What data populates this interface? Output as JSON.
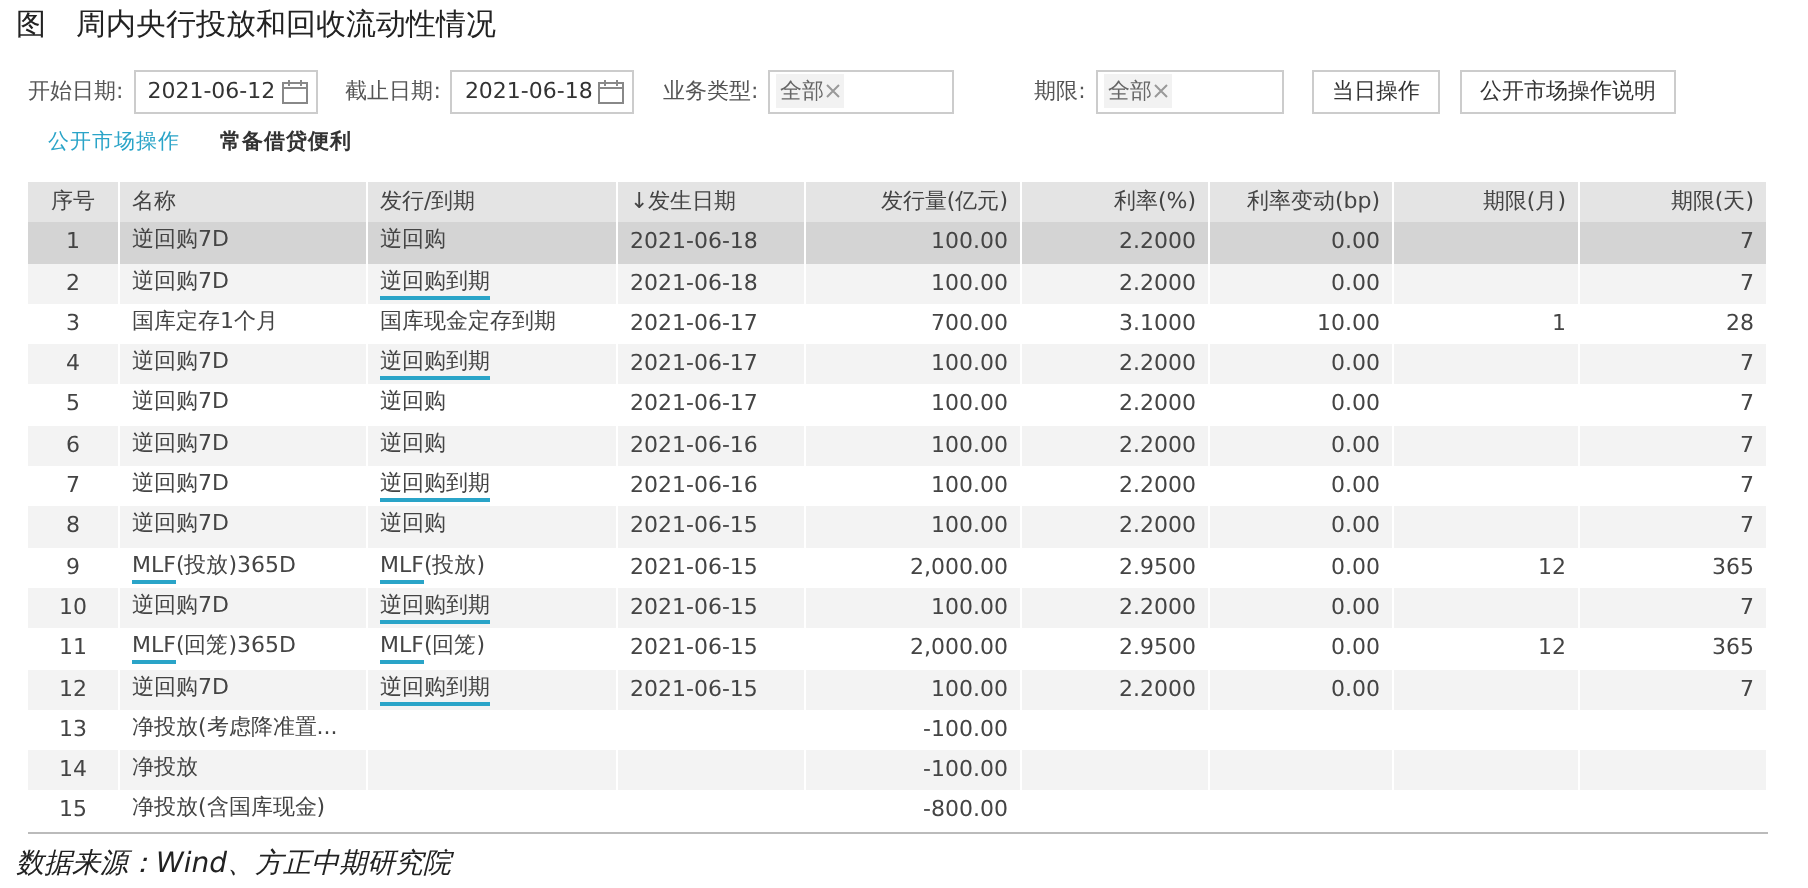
{
  "title": "图　周内央行投放和回收流动性情况",
  "filters": [
    {
      "label": "开始日期:",
      "kind": "date",
      "value": "2021-06-12"
    },
    {
      "label": "截止日期:",
      "kind": "date",
      "value": "2021-06-18"
    },
    {
      "label": "业务类型:",
      "kind": "tags",
      "value": "全部"
    },
    {
      "label": "期限:",
      "kind": "tags",
      "value": "全部"
    }
  ],
  "buttons": [
    "当日操作",
    "公开市场操作说明"
  ],
  "tabs": [
    {
      "label": "公开市场操作",
      "selected": true
    },
    {
      "label": "常备借贷便利",
      "selected": false
    }
  ],
  "table": {
    "columns": [
      "序号",
      "名称",
      "发行/到期",
      "↓发生日期",
      "发行量(亿元)",
      "利率(%)",
      "利率变动(bp)",
      "期限(月)",
      "期限(天)"
    ],
    "rows": [
      {
        "selected": true,
        "cells": [
          "1",
          [
            {
              "text": "逆回购7D",
              "link": false
            }
          ],
          [
            {
              "text": "逆回购",
              "link": false
            }
          ],
          "2021-06-18",
          "100.00",
          "2.2000",
          "0.00",
          "",
          "7"
        ]
      },
      {
        "selected": false,
        "cells": [
          "2",
          [
            {
              "text": "逆回购7D",
              "link": false
            }
          ],
          [
            {
              "text": "逆回购到期",
              "link": true
            }
          ],
          "2021-06-18",
          "100.00",
          "2.2000",
          "0.00",
          "",
          "7"
        ]
      },
      {
        "selected": false,
        "cells": [
          "3",
          [
            {
              "text": "国库定存1个月",
              "link": false
            }
          ],
          [
            {
              "text": "国库现金定存到期",
              "link": false
            }
          ],
          "2021-06-17",
          "700.00",
          "3.1000",
          "10.00",
          "1",
          "28"
        ]
      },
      {
        "selected": false,
        "cells": [
          "4",
          [
            {
              "text": "逆回购7D",
              "link": false
            }
          ],
          [
            {
              "text": "逆回购到期",
              "link": true
            }
          ],
          "2021-06-17",
          "100.00",
          "2.2000",
          "0.00",
          "",
          "7"
        ]
      },
      {
        "selected": false,
        "cells": [
          "5",
          [
            {
              "text": "逆回购7D",
              "link": false
            }
          ],
          [
            {
              "text": "逆回购",
              "link": false
            }
          ],
          "2021-06-17",
          "100.00",
          "2.2000",
          "0.00",
          "",
          "7"
        ]
      },
      {
        "selected": false,
        "cells": [
          "6",
          [
            {
              "text": "逆回购7D",
              "link": false
            }
          ],
          [
            {
              "text": "逆回购",
              "link": false
            }
          ],
          "2021-06-16",
          "100.00",
          "2.2000",
          "0.00",
          "",
          "7"
        ]
      },
      {
        "selected": false,
        "cells": [
          "7",
          [
            {
              "text": "逆回购7D",
              "link": false
            }
          ],
          [
            {
              "text": "逆回购到期",
              "link": true
            }
          ],
          "2021-06-16",
          "100.00",
          "2.2000",
          "0.00",
          "",
          "7"
        ]
      },
      {
        "selected": false,
        "cells": [
          "8",
          [
            {
              "text": "逆回购7D",
              "link": false
            }
          ],
          [
            {
              "text": "逆回购",
              "link": false
            }
          ],
          "2021-06-15",
          "100.00",
          "2.2000",
          "0.00",
          "",
          "7"
        ]
      },
      {
        "selected": false,
        "cells": [
          "9",
          [
            {
              "text": "MLF",
              "link": true
            },
            {
              "text": "(投放)365D",
              "link": false
            }
          ],
          [
            {
              "text": "MLF",
              "link": true
            },
            {
              "text": "(投放)",
              "link": false
            }
          ],
          "2021-06-15",
          "2,000.00",
          "2.9500",
          "0.00",
          "12",
          "365"
        ]
      },
      {
        "selected": false,
        "cells": [
          "10",
          [
            {
              "text": "逆回购7D",
              "link": false
            }
          ],
          [
            {
              "text": "逆回购到期",
              "link": true
            }
          ],
          "2021-06-15",
          "100.00",
          "2.2000",
          "0.00",
          "",
          "7"
        ]
      },
      {
        "selected": false,
        "cells": [
          "11",
          [
            {
              "text": "MLF",
              "link": true
            },
            {
              "text": "(回笼)365D",
              "link": false
            }
          ],
          [
            {
              "text": "MLF",
              "link": true
            },
            {
              "text": "(回笼)",
              "link": false
            }
          ],
          "2021-06-15",
          "2,000.00",
          "2.9500",
          "0.00",
          "12",
          "365"
        ]
      },
      {
        "selected": false,
        "cells": [
          "12",
          [
            {
              "text": "逆回购7D",
              "link": false
            }
          ],
          [
            {
              "text": "逆回购到期",
              "link": true
            }
          ],
          "2021-06-15",
          "100.00",
          "2.2000",
          "0.00",
          "",
          "7"
        ]
      },
      {
        "selected": false,
        "cells": [
          "13",
          [
            {
              "text": "净投放(考虑降准置...",
              "link": false
            }
          ],
          [],
          "",
          "-100.00",
          "",
          "",
          "",
          ""
        ]
      },
      {
        "selected": false,
        "cells": [
          "14",
          [
            {
              "text": "净投放",
              "link": false
            }
          ],
          [],
          "",
          "-100.00",
          "",
          "",
          "",
          ""
        ]
      },
      {
        "selected": false,
        "cells": [
          "15",
          [
            {
              "text": "净投放(含国库现金)",
              "link": false
            }
          ],
          [],
          "",
          "-800.00",
          "",
          "",
          "",
          ""
        ]
      }
    ]
  },
  "source": "数据来源：Wind、方正中期研究院"
}
